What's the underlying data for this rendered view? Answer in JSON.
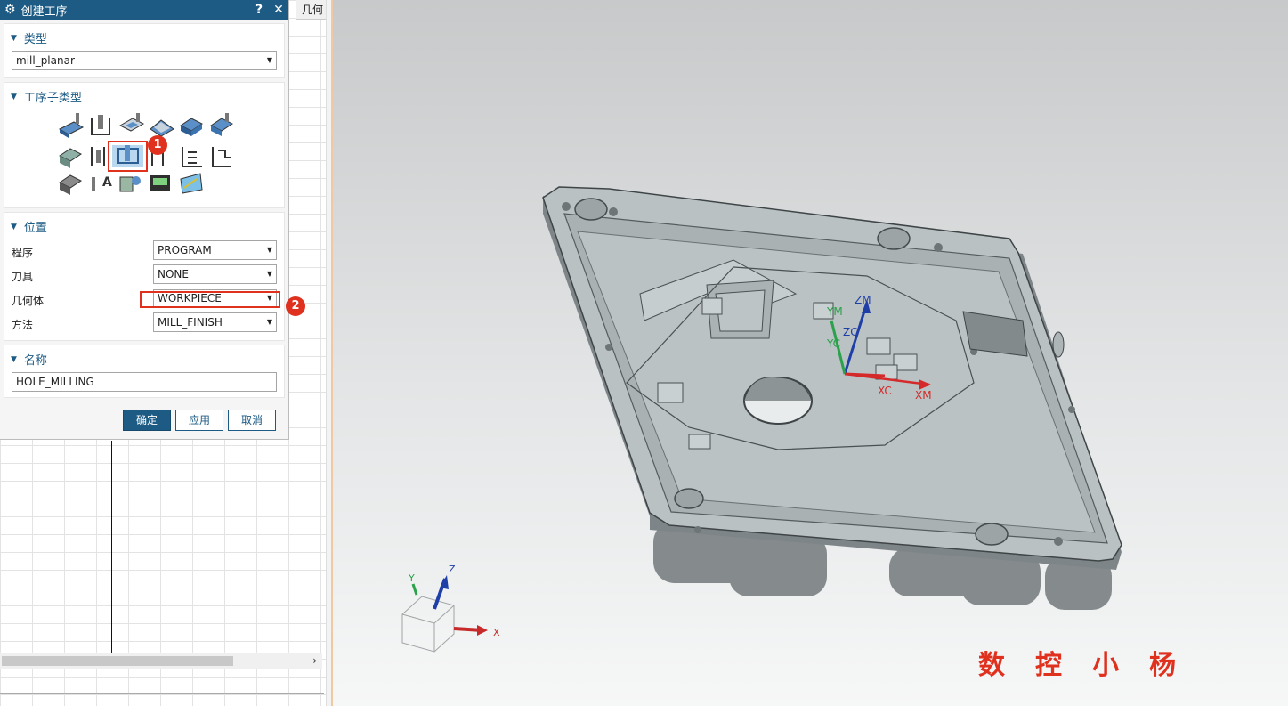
{
  "navigator": {
    "column_header": "几何"
  },
  "dialog": {
    "title": "创建工序",
    "help_button": "?",
    "close_button": "✕",
    "type_section": {
      "heading": "类型",
      "value": "mill_planar"
    },
    "subtype_section": {
      "heading": "工序子类型",
      "icons": [
        "face-mill-icon",
        "floor-wall-icon",
        "pocket-icon",
        "profile-icon",
        "planar-mill-icon",
        "floor-wall-is-icon",
        "groove-mill-icon",
        "hole-mill-icon",
        "thread-mill-icon",
        "chamfer-icon",
        "solid-profile-icon",
        "planar-profile-icon",
        "cleanup-corners-icon",
        "text-mill-icon",
        "user-defined-icon",
        "probe-icon",
        "pattern-icon"
      ],
      "selected_badge": "1"
    },
    "location_section": {
      "heading": "位置",
      "program_label": "程序",
      "program_value": "PROGRAM",
      "tool_label": "刀具",
      "tool_value": "NONE",
      "geometry_label": "几何体",
      "geometry_value": "WORKPIECE",
      "method_label": "方法",
      "method_value": "MILL_FINISH",
      "geometry_badge": "2"
    },
    "name_section": {
      "heading": "名称",
      "value": "HOLE_MILLING"
    },
    "buttons": {
      "ok": "确定",
      "apply": "应用",
      "cancel": "取消"
    }
  },
  "viewport": {
    "wcs_labels": {
      "zm": "ZM",
      "ym": "YM",
      "xm": "XM",
      "zc": "ZC",
      "yc": "YC",
      "xc": "XC"
    },
    "triad_labels": {
      "x": "X",
      "y": "Y",
      "z": "Z"
    },
    "watermark": "数控小杨",
    "watermark_chars": [
      "数",
      "控",
      "小",
      "杨"
    ]
  },
  "colors": {
    "title_bar": "#1d5b84",
    "highlight": "#e0301e",
    "part": "#b9c1c3"
  }
}
